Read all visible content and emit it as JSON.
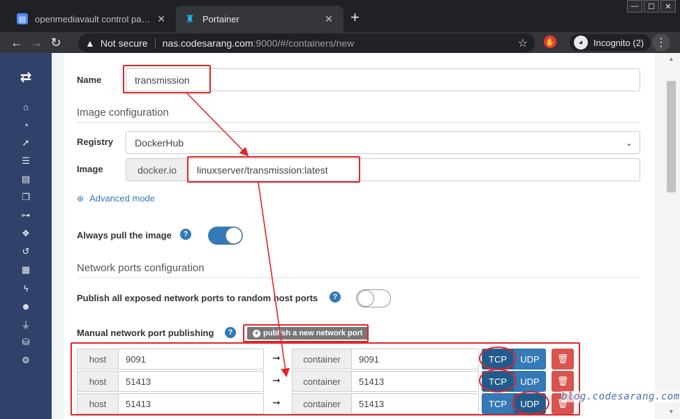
{
  "browser": {
    "tabs": [
      {
        "title": "openmediavault control panel - n",
        "active": false
      },
      {
        "title": "Portainer",
        "active": true
      }
    ],
    "address": {
      "security_label": "Not secure",
      "host": "nas.codesarang.com",
      "path": ":9000/#/containers/new"
    },
    "profile_label": "Incognito (2)"
  },
  "form": {
    "name_label": "Name",
    "name_value": "transmission",
    "image_section": "Image configuration",
    "registry_label": "Registry",
    "registry_value": "DockerHub",
    "image_label": "Image",
    "image_prefix": "docker.io",
    "image_value": "linuxserver/transmission:latest",
    "advanced_mode": "Advanced mode",
    "always_pull_label": "Always pull the image",
    "always_pull_on": true,
    "network_section": "Network ports configuration",
    "publish_all_label": "Publish all exposed network ports to random host ports",
    "publish_all_on": false,
    "manual_label": "Manual network port publishing",
    "publish_button": "publish a new network port",
    "host_addon": "host",
    "container_addon": "container",
    "tcp_label": "TCP",
    "udp_label": "UDP",
    "ports": [
      {
        "host": "9091",
        "container": "9091",
        "protocol": "TCP"
      },
      {
        "host": "51413",
        "container": "51413",
        "protocol": "TCP"
      },
      {
        "host": "51413",
        "container": "51413",
        "protocol": "UDP"
      }
    ]
  },
  "watermark": "blog.codesarang.com",
  "colors": {
    "sidebar": "#30426a",
    "primary": "#337ab7",
    "danger": "#d9534f",
    "annotation": "#e0252b"
  }
}
